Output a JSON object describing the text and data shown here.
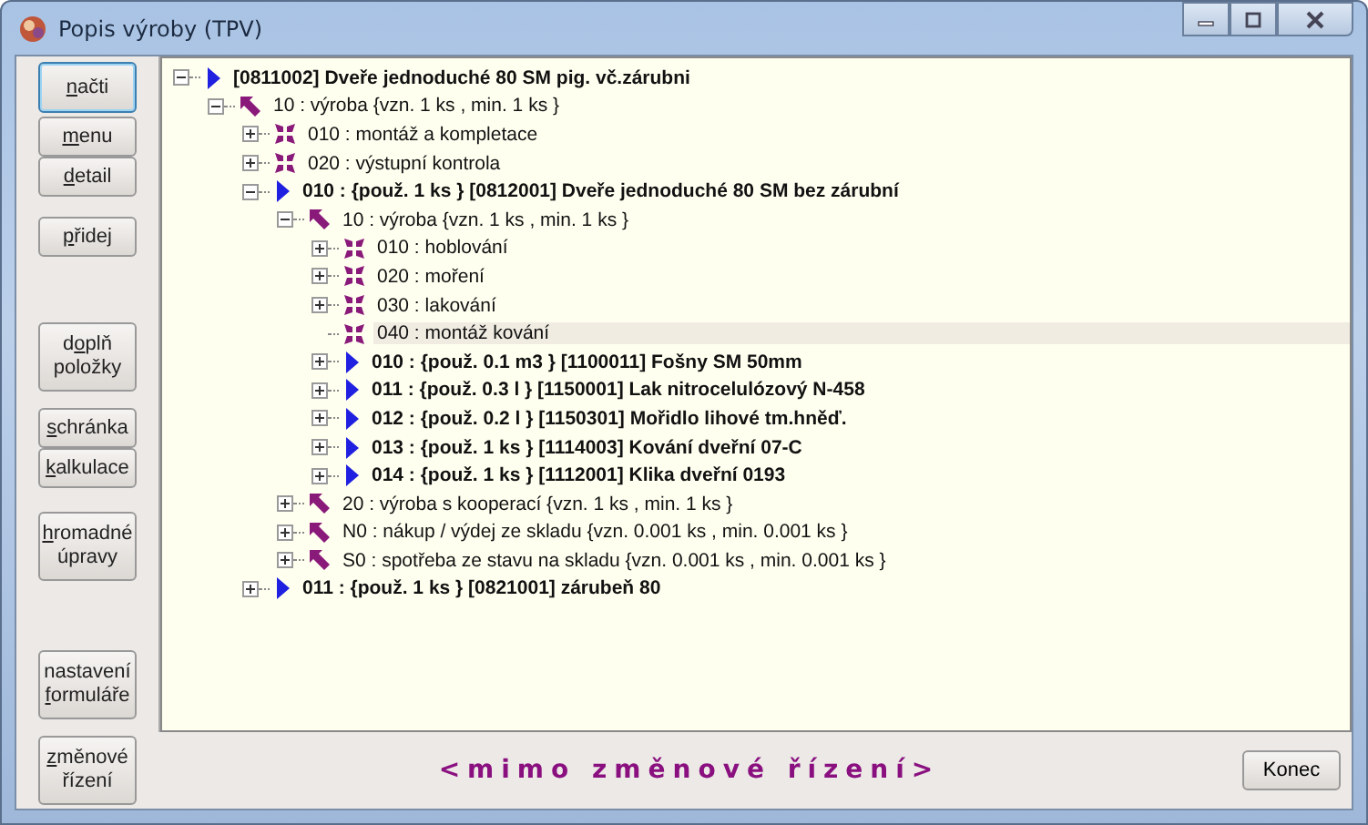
{
  "window": {
    "title": "Popis výroby (TPV)"
  },
  "button_groups": [
    [
      {
        "lines": [
          [
            {
              "text": "n",
              "underline": true
            },
            {
              "text": "ačti",
              "underline": false
            }
          ]
        ],
        "focused": true
      }
    ],
    [
      {
        "lines": [
          [
            {
              "text": "m",
              "underline": true
            },
            {
              "text": "enu",
              "underline": false
            }
          ]
        ],
        "focused": false
      },
      {
        "lines": [
          [
            {
              "text": "d",
              "underline": true
            },
            {
              "text": "etail",
              "underline": false
            }
          ]
        ],
        "focused": false
      }
    ],
    [
      {
        "lines": [
          [
            {
              "text": "p",
              "underline": true
            },
            {
              "text": "řidej",
              "underline": false
            }
          ]
        ],
        "focused": false
      }
    ],
    [
      {
        "lines": [
          [
            {
              "text": "d",
              "underline": false
            },
            {
              "text": "o",
              "underline": true
            },
            {
              "text": "plň",
              "underline": false
            }
          ],
          [
            {
              "text": "položky",
              "underline": false
            }
          ]
        ],
        "focused": false
      }
    ],
    [
      {
        "lines": [
          [
            {
              "text": "s",
              "underline": true
            },
            {
              "text": "chránka",
              "underline": false
            }
          ]
        ],
        "focused": false
      },
      {
        "lines": [
          [
            {
              "text": "k",
              "underline": true
            },
            {
              "text": "alkulace",
              "underline": false
            }
          ]
        ],
        "focused": false
      }
    ],
    [
      {
        "lines": [
          [
            {
              "text": "h",
              "underline": true
            },
            {
              "text": "romadné",
              "underline": false
            }
          ],
          [
            {
              "text": "úpravy",
              "underline": false
            }
          ]
        ],
        "focused": false
      }
    ],
    [
      {
        "lines": [
          [
            {
              "text": "nastavení",
              "underline": false
            }
          ],
          [
            {
              "text": "f",
              "underline": true
            },
            {
              "text": "ormuláře",
              "underline": false
            }
          ]
        ],
        "focused": false
      }
    ]
  ],
  "tree": [
    {
      "kind": "item",
      "text": "[0811002] Dveře jednoduché 80 SM pig. vč.zárubni",
      "bold": true,
      "expandable": true,
      "expanded": true,
      "selected": false,
      "children": [
        {
          "kind": "process",
          "text": "10 : výroba {vzn. 1  ks , min. 1  ks }",
          "bold": false,
          "expandable": true,
          "expanded": true,
          "selected": false,
          "children": [
            {
              "kind": "operation",
              "text": "010 : montáž a kompletace",
              "bold": false,
              "expandable": true,
              "expanded": false,
              "selected": false
            },
            {
              "kind": "operation",
              "text": "020 : výstupní kontrola",
              "bold": false,
              "expandable": true,
              "expanded": false,
              "selected": false
            },
            {
              "kind": "item",
              "text": "010 : {použ. 1  ks } [0812001] Dveře jednoduché 80 SM bez zárubní",
              "bold": true,
              "expandable": true,
              "expanded": true,
              "selected": false,
              "children": [
                {
                  "kind": "process",
                  "text": "10 : výroba {vzn. 1  ks , min. 1  ks }",
                  "bold": false,
                  "expandable": true,
                  "expanded": true,
                  "selected": false,
                  "children": [
                    {
                      "kind": "operation",
                      "text": "010 : hoblování",
                      "bold": false,
                      "expandable": true,
                      "expanded": false,
                      "selected": false
                    },
                    {
                      "kind": "operation",
                      "text": "020 : moření",
                      "bold": false,
                      "expandable": true,
                      "expanded": false,
                      "selected": false
                    },
                    {
                      "kind": "operation",
                      "text": "030 : lakování",
                      "bold": false,
                      "expandable": true,
                      "expanded": false,
                      "selected": false
                    },
                    {
                      "kind": "operation",
                      "text": "040 : montáž kování",
                      "bold": false,
                      "expandable": false,
                      "selected": true
                    },
                    {
                      "kind": "item",
                      "text": "010 : {použ. 0.1  m3 } [1100011] Fošny SM 50mm",
                      "bold": true,
                      "expandable": true,
                      "expanded": false,
                      "selected": false
                    },
                    {
                      "kind": "item",
                      "text": "011 : {použ. 0.3  l  } [1150001] Lak nitrocelulózový N-458",
                      "bold": true,
                      "expandable": true,
                      "expanded": false,
                      "selected": false
                    },
                    {
                      "kind": "item",
                      "text": "012 : {použ. 0.2  l  } [1150301] Mořidlo lihové tm.hněď.",
                      "bold": true,
                      "expandable": true,
                      "expanded": false,
                      "selected": false
                    },
                    {
                      "kind": "item",
                      "text": "013 : {použ. 1  ks } [1114003] Kování dveřní 07-C",
                      "bold": true,
                      "expandable": true,
                      "expanded": false,
                      "selected": false
                    },
                    {
                      "kind": "item",
                      "text": "014 : {použ. 1  ks } [1112001] Klika dveřní 0193",
                      "bold": true,
                      "expandable": true,
                      "expanded": false,
                      "selected": false
                    }
                  ]
                },
                {
                  "kind": "process",
                  "text": "20 : výroba s kooperací {vzn. 1  ks , min. 1  ks }",
                  "bold": false,
                  "expandable": true,
                  "expanded": false,
                  "selected": false
                },
                {
                  "kind": "process",
                  "text": "N0 : nákup / výdej ze skladu {vzn. 0.001  ks , min. 0.001  ks }",
                  "bold": false,
                  "expandable": true,
                  "expanded": false,
                  "selected": false
                },
                {
                  "kind": "process",
                  "text": "S0 : spotřeba ze stavu na skladu {vzn. 0.001  ks , min. 0.001  ks }",
                  "bold": false,
                  "expandable": true,
                  "expanded": false,
                  "selected": false
                }
              ]
            },
            {
              "kind": "item",
              "text": "011 : {použ. 1  ks } [0821001] zárubeň 80",
              "bold": true,
              "expandable": true,
              "expanded": false,
              "selected": false
            }
          ]
        }
      ]
    }
  ],
  "bottom_button": {
    "lines": [
      [
        {
          "text": "z",
          "underline": true
        },
        {
          "text": "měnové",
          "underline": false
        }
      ],
      [
        {
          "text": "řízení",
          "underline": false
        }
      ]
    ],
    "focused": false
  },
  "status": "<mimo změnové řízení>",
  "close_button": "Konec"
}
